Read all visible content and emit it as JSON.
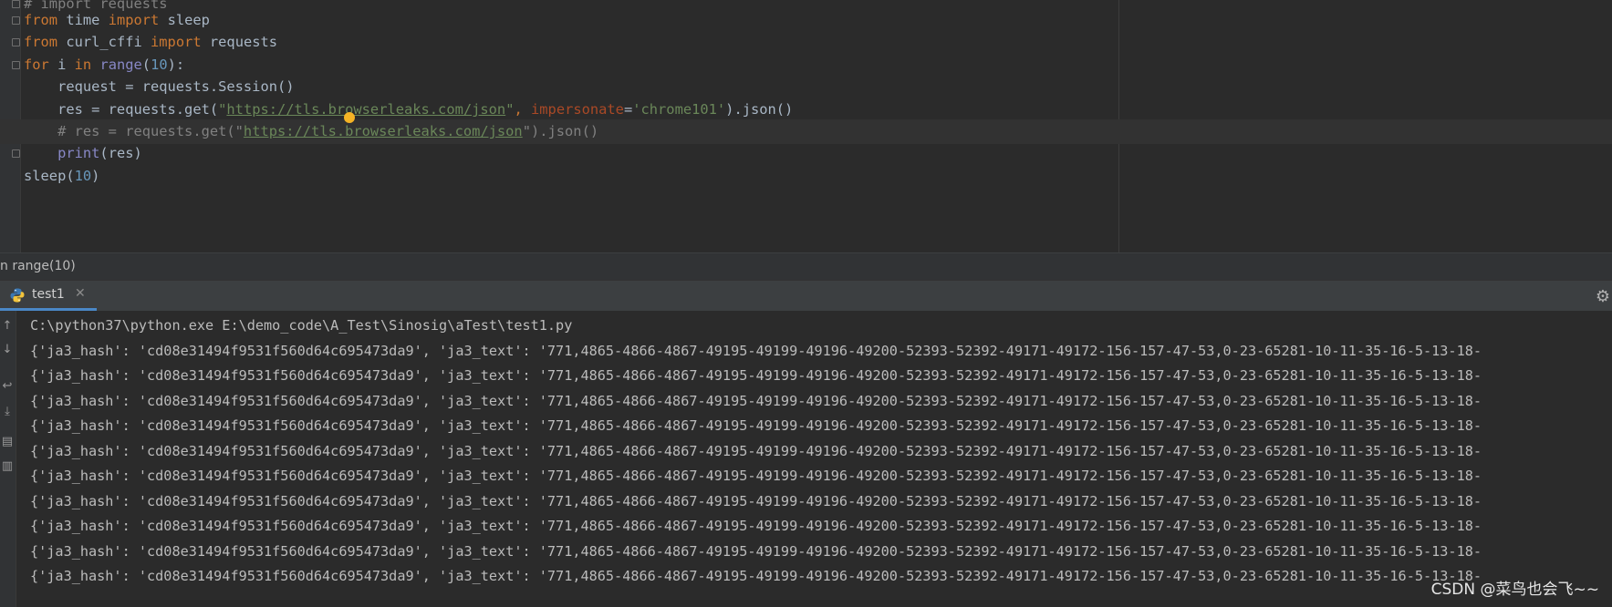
{
  "editor": {
    "lines": [
      [
        {
          "t": "# import requests",
          "c": "cmt"
        }
      ],
      [
        {
          "t": "from",
          "c": "kw"
        },
        {
          "t": " time ",
          "c": ""
        },
        {
          "t": "import",
          "c": "kw"
        },
        {
          "t": " sleep",
          "c": ""
        }
      ],
      [
        {
          "t": "from",
          "c": "kw"
        },
        {
          "t": " curl_cffi ",
          "c": ""
        },
        {
          "t": "import",
          "c": "kw"
        },
        {
          "t": " requests",
          "c": ""
        }
      ],
      [
        {
          "t": "for",
          "c": "kw"
        },
        {
          "t": " i ",
          "c": ""
        },
        {
          "t": "in",
          "c": "kw"
        },
        {
          "t": " ",
          "c": ""
        },
        {
          "t": "range",
          "c": "bi"
        },
        {
          "t": "(",
          "c": ""
        },
        {
          "t": "10",
          "c": "num"
        },
        {
          "t": "):",
          "c": ""
        }
      ],
      [
        {
          "t": "    request = requests.Session()",
          "c": ""
        }
      ],
      [
        {
          "t": "    res = requests.get(",
          "c": ""
        },
        {
          "t": "\"",
          "c": "str"
        },
        {
          "t": "https://tls.browserleaks.com/json",
          "c": "url"
        },
        {
          "t": "\"",
          "c": "str"
        },
        {
          "t": ", ",
          "c": "kw"
        },
        {
          "t": "impersonate",
          "c": "param"
        },
        {
          "t": "=",
          "c": ""
        },
        {
          "t": "'chrome101'",
          "c": "str"
        },
        {
          "t": ").json()",
          "c": ""
        }
      ],
      [
        {
          "t": "    # res = requests.get(\"",
          "c": "cmt"
        },
        {
          "t": "https://tls.browserleaks.com/json",
          "c": "url"
        },
        {
          "t": "\").json()",
          "c": "cmt"
        }
      ],
      [
        {
          "t": "    ",
          "c": ""
        },
        {
          "t": "print",
          "c": "bi"
        },
        {
          "t": "(res)",
          "c": ""
        }
      ],
      [
        {
          "t": "sleep(",
          "c": ""
        },
        {
          "t": "10",
          "c": "num"
        },
        {
          "t": ")",
          "c": ""
        }
      ]
    ],
    "current_line_index": 6
  },
  "breadcrumb": {
    "text": "n range(10)"
  },
  "run_panel": {
    "tab_label": "test1",
    "command": "C:\\python37\\python.exe E:\\demo_code\\A_Test\\Sinosig\\aTest\\test1.py",
    "output_line": "{'ja3_hash': 'cd08e31494f9531f560d64c695473da9', 'ja3_text': '771,4865-4866-4867-49195-49199-49196-49200-52393-52392-49171-49172-156-157-47-53,0-23-65281-10-11-35-16-5-13-18-",
    "output_count": 10,
    "icons": {
      "tab": "python-icon",
      "close": "close-icon",
      "settings": "gear-icon",
      "tools": [
        "arrow-up-icon",
        "arrow-down-icon",
        "soft-wrap-icon",
        "scroll-to-end-icon",
        "print-icon",
        "trash-icon"
      ]
    }
  },
  "watermark": "CSDN @菜鸟也会飞~~"
}
